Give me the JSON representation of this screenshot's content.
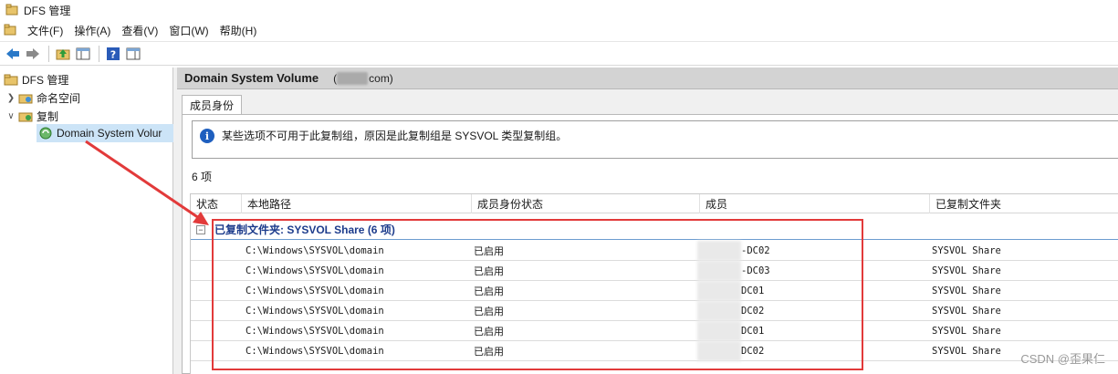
{
  "window": {
    "title": "DFS 管理"
  },
  "menu": {
    "items": [
      "文件(F)",
      "操作(A)",
      "查看(V)",
      "窗口(W)",
      "帮助(H)"
    ]
  },
  "toolbar": {
    "buttons": [
      "back-icon",
      "forward-icon",
      "folder-up-icon",
      "show-hide-tree-icon",
      "help-icon",
      "action-pane-icon"
    ]
  },
  "tree": {
    "root": "DFS 管理",
    "namespaces": "命名空间",
    "replication": "复制",
    "selected": "Domain System Volur"
  },
  "panel": {
    "title": "Domain System Volume",
    "domain_prefix": "(",
    "domain_suffix": "com)",
    "tab": "成员身份",
    "info": "某些选项不可用于此复制组，原因是此复制组是 SYSVOL 类型复制组。",
    "count": "6 项"
  },
  "grid": {
    "columns": [
      "状态",
      "本地路径",
      "成员身份状态",
      "成员",
      "已复制文件夹"
    ],
    "group_label": "已复制文件夹: SYSVOL Share (6 项)",
    "rows": [
      {
        "path": "C:\\Windows\\SYSVOL\\domain",
        "state": "已启用",
        "member": "-DC02",
        "folder": "SYSVOL Share"
      },
      {
        "path": "C:\\Windows\\SYSVOL\\domain",
        "state": "已启用",
        "member": "-DC03",
        "folder": "SYSVOL Share"
      },
      {
        "path": "C:\\Windows\\SYSVOL\\domain",
        "state": "已启用",
        "member": "DC01",
        "folder": "SYSVOL Share"
      },
      {
        "path": "C:\\Windows\\SYSVOL\\domain",
        "state": "已启用",
        "member": "DC02",
        "folder": "SYSVOL Share"
      },
      {
        "path": "C:\\Windows\\SYSVOL\\domain",
        "state": "已启用",
        "member": "DC01",
        "folder": "SYSVOL Share"
      },
      {
        "path": "C:\\Windows\\SYSVOL\\domain",
        "state": "已启用",
        "member": "DC02",
        "folder": "SYSVOL Share"
      }
    ]
  },
  "watermark": "CSDN @歪果仁",
  "colors": {
    "annotation_red": "#e23a3a",
    "group_blue": "#1d3c8c",
    "header_gray": "#d3d3d3"
  }
}
